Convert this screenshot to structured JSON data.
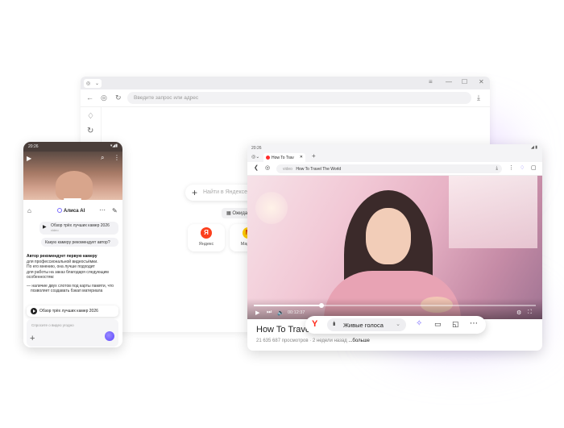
{
  "desktop": {
    "tab_icon": "yandex-tab-icon",
    "address_placeholder": "Введите запрос или адрес",
    "search_placeholder": "Найти в Яндексе и",
    "chip_label": "Ожидани",
    "tiles": [
      {
        "label": "Яндекс",
        "letter": "Я",
        "color": "#fc3f1d"
      },
      {
        "label": "Маркет",
        "letter": "М",
        "color": "#ffcc00"
      }
    ]
  },
  "phone": {
    "time": "20:26",
    "header_title": "Алиса AI",
    "video_request": "Обзор трёх лучших камер 2026",
    "video_sub": "video",
    "question": "Какую камеру рекомендует автор?",
    "answer_bold": "Автор рекомендует первую камеру",
    "answer_lines": [
      "для профессиональной видеосъёмки.",
      "По его мнению, она лучше подходит",
      "для работы на заказ благодаря следующим",
      "особенностям:"
    ],
    "bullet_lines": [
      "— наличие двух слотов под карты памяти, что",
      "позволяет создавать бэкап материала"
    ],
    "card_title": "Обзор трёх лучших камер 2026",
    "input_placeholder": "Спросите о видео угодно"
  },
  "tablet": {
    "time": "20:26",
    "tab_title": "How To Trav",
    "address_host": "video",
    "address_title": "How To Travel The World",
    "video_time": "00:12:37",
    "video_title": "How To Trave",
    "meta": "21 635 687 просмотров · 2 недели назад",
    "more": "...больше",
    "progress": 0.24
  },
  "toolbar": {
    "voice_label": "Живые голоса"
  },
  "colors": {
    "accent": "#7a6cff",
    "brand_red": "#ff2a1a"
  }
}
